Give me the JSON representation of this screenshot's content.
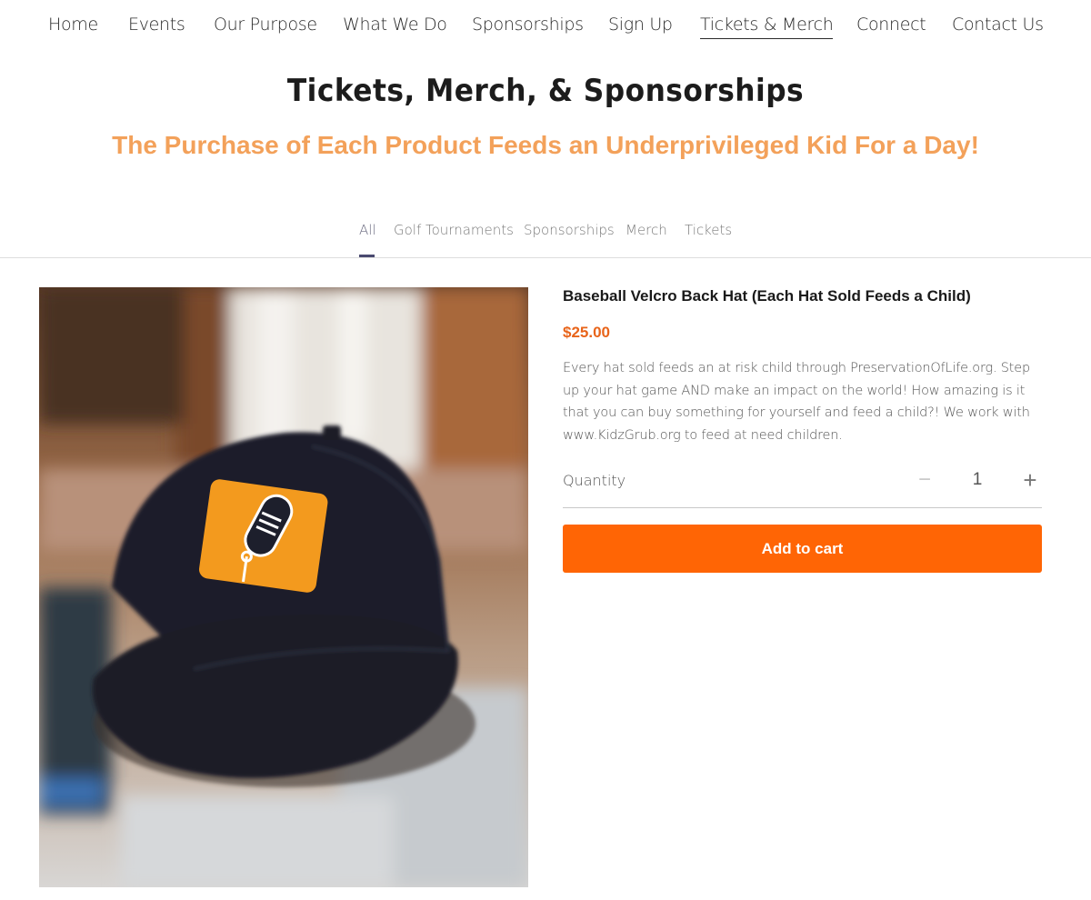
{
  "nav": {
    "items": [
      {
        "label": "Home",
        "active": false
      },
      {
        "label": "Events",
        "active": false
      },
      {
        "label": "Our Purpose",
        "active": false
      },
      {
        "label": "What We Do",
        "active": false
      },
      {
        "label": "Sponsorships",
        "active": false
      },
      {
        "label": "Sign Up",
        "active": false
      },
      {
        "label": "Tickets & Merch",
        "active": true
      },
      {
        "label": "Connect",
        "active": false
      },
      {
        "label": "Contact Us",
        "active": false
      }
    ]
  },
  "page": {
    "title": "Tickets, Merch, & Sponsorships",
    "subtitle": "The Purchase of Each Product Feeds an Underprivileged Kid For a Day!"
  },
  "categories": {
    "tabs": [
      {
        "label": "All",
        "active": true
      },
      {
        "label": "Golf Tournaments",
        "active": false
      },
      {
        "label": "Sponsorships",
        "active": false
      },
      {
        "label": "Merch",
        "active": false
      },
      {
        "label": "Tickets",
        "active": false
      }
    ]
  },
  "product": {
    "name": "Baseball Velcro Back Hat (Each Hat Sold Feeds a Child)",
    "price": "$25.00",
    "description": "Every hat sold feeds an at risk child through PreservationOfLife.org. Step up your hat game AND make an impact on the world! How amazing is it that you can buy something for yourself and feed a child?! We work with www.KidzGrub.org to feed at need children.",
    "quantity_label": "Quantity",
    "quantity": "1",
    "minus": "−",
    "plus": "+",
    "add_to_cart": "Add to cart"
  },
  "colors": {
    "accent": "#ff6505",
    "price": "#e8641a",
    "subtitle": "#f3a15a"
  }
}
